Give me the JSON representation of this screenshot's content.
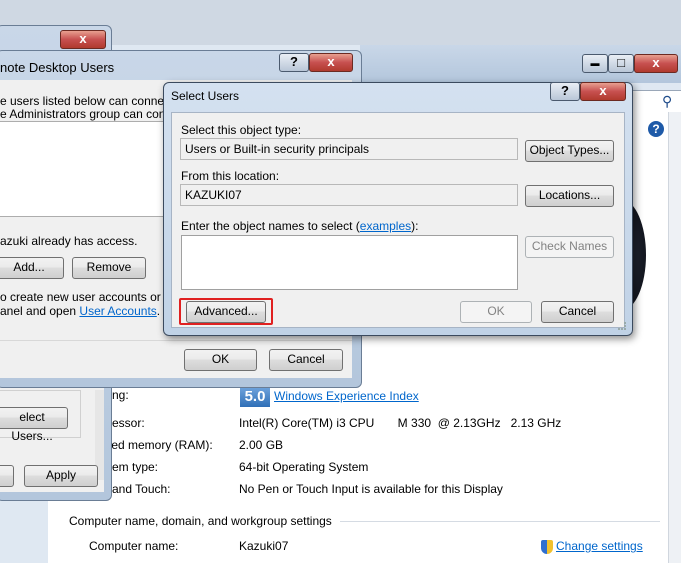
{
  "sysprops": {
    "wei_score": "5.0",
    "wei_label": "Windows Experience Index",
    "rows": [
      {
        "label": "ng:",
        "value": ""
      },
      {
        "label": "essor:",
        "value": "Intel(R) Core(TM) i3 CPU       M 330  @ 2.13GHz   2.13 GHz"
      },
      {
        "label": "lled memory (RAM):",
        "value": "2.00 GB"
      },
      {
        "label": "em type:",
        "value": "64-bit Operating System"
      },
      {
        "label": "and Touch:",
        "value": "No Pen or Touch Input is available for this Display"
      }
    ],
    "section": "Computer name, domain, and workgroup settings",
    "computer_name_label": "Computer name:",
    "computer_name_value": "Kazuki07",
    "change_settings": "Change settings",
    "help_glyph": "?"
  },
  "sysdlg": {
    "select_users_btn": "elect Users...",
    "apply_btn": "Apply"
  },
  "rdu": {
    "title": "note Desktop Users",
    "desc1": "e users listed below can connect t",
    "desc2": "e Administrators group can connec",
    "access_text": "azuki already has access.",
    "add_btn": "Add...",
    "remove_btn": "Remove",
    "create_text1": "o create new user accounts or add",
    "create_text2": "anel and open",
    "user_accounts_link": "User Accounts",
    "period": ".",
    "ok_btn": "OK",
    "cancel_btn": "Cancel"
  },
  "select_users": {
    "title": "Select Users",
    "object_type_label": "Select this object type:",
    "object_type_value": "Users or Built-in security principals",
    "object_types_btn": "Object Types...",
    "location_label": "From this location:",
    "location_value": "KAZUKI07",
    "locations_btn": "Locations...",
    "enter_label": "Enter the object names to select (",
    "examples_link": "examples",
    "enter_label_end": "):",
    "names_value": "",
    "check_names_btn": "Check Names",
    "advanced_btn": "Advanced...",
    "ok_btn": "OK",
    "cancel_btn": "Cancel",
    "help_glyph": "?",
    "close_glyph": "x"
  },
  "caption": {
    "help": "?",
    "close": "x",
    "minimize": "▬",
    "maximize": "□"
  },
  "colors": {
    "highlight_red": "#e02020",
    "link_blue": "#0066cc"
  }
}
